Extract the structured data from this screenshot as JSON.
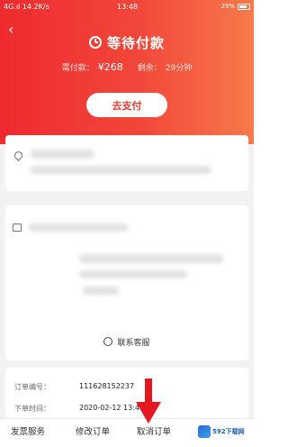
{
  "status_bar": {
    "left": "4G.ıl 14.2K/s",
    "time": "13:48",
    "right": "29%"
  },
  "header": {
    "back_icon": "chevron-left-icon",
    "title": "等待付款",
    "amount_label": "需付款：",
    "amount_value": "¥268",
    "remaining_label": "剩余：",
    "remaining_value": "29分钟",
    "pay_button": "去支付"
  },
  "goods_card": {
    "service_label": "联系客服"
  },
  "order_info": {
    "order_no_label": "订单编号：",
    "order_no_value": "111628152237",
    "order_time_label": "下单时间：",
    "order_time_value": "2020-02-12 13:4"
  },
  "bottom_bar": {
    "invoice": "发票服务",
    "modify": "修改订单",
    "cancel": "取消订单"
  },
  "watermark": {
    "text": "592下载网"
  },
  "colors": {
    "header_start": "#ee2a2f",
    "header_end": "#f87a4a",
    "arrow": "#e3191f"
  }
}
